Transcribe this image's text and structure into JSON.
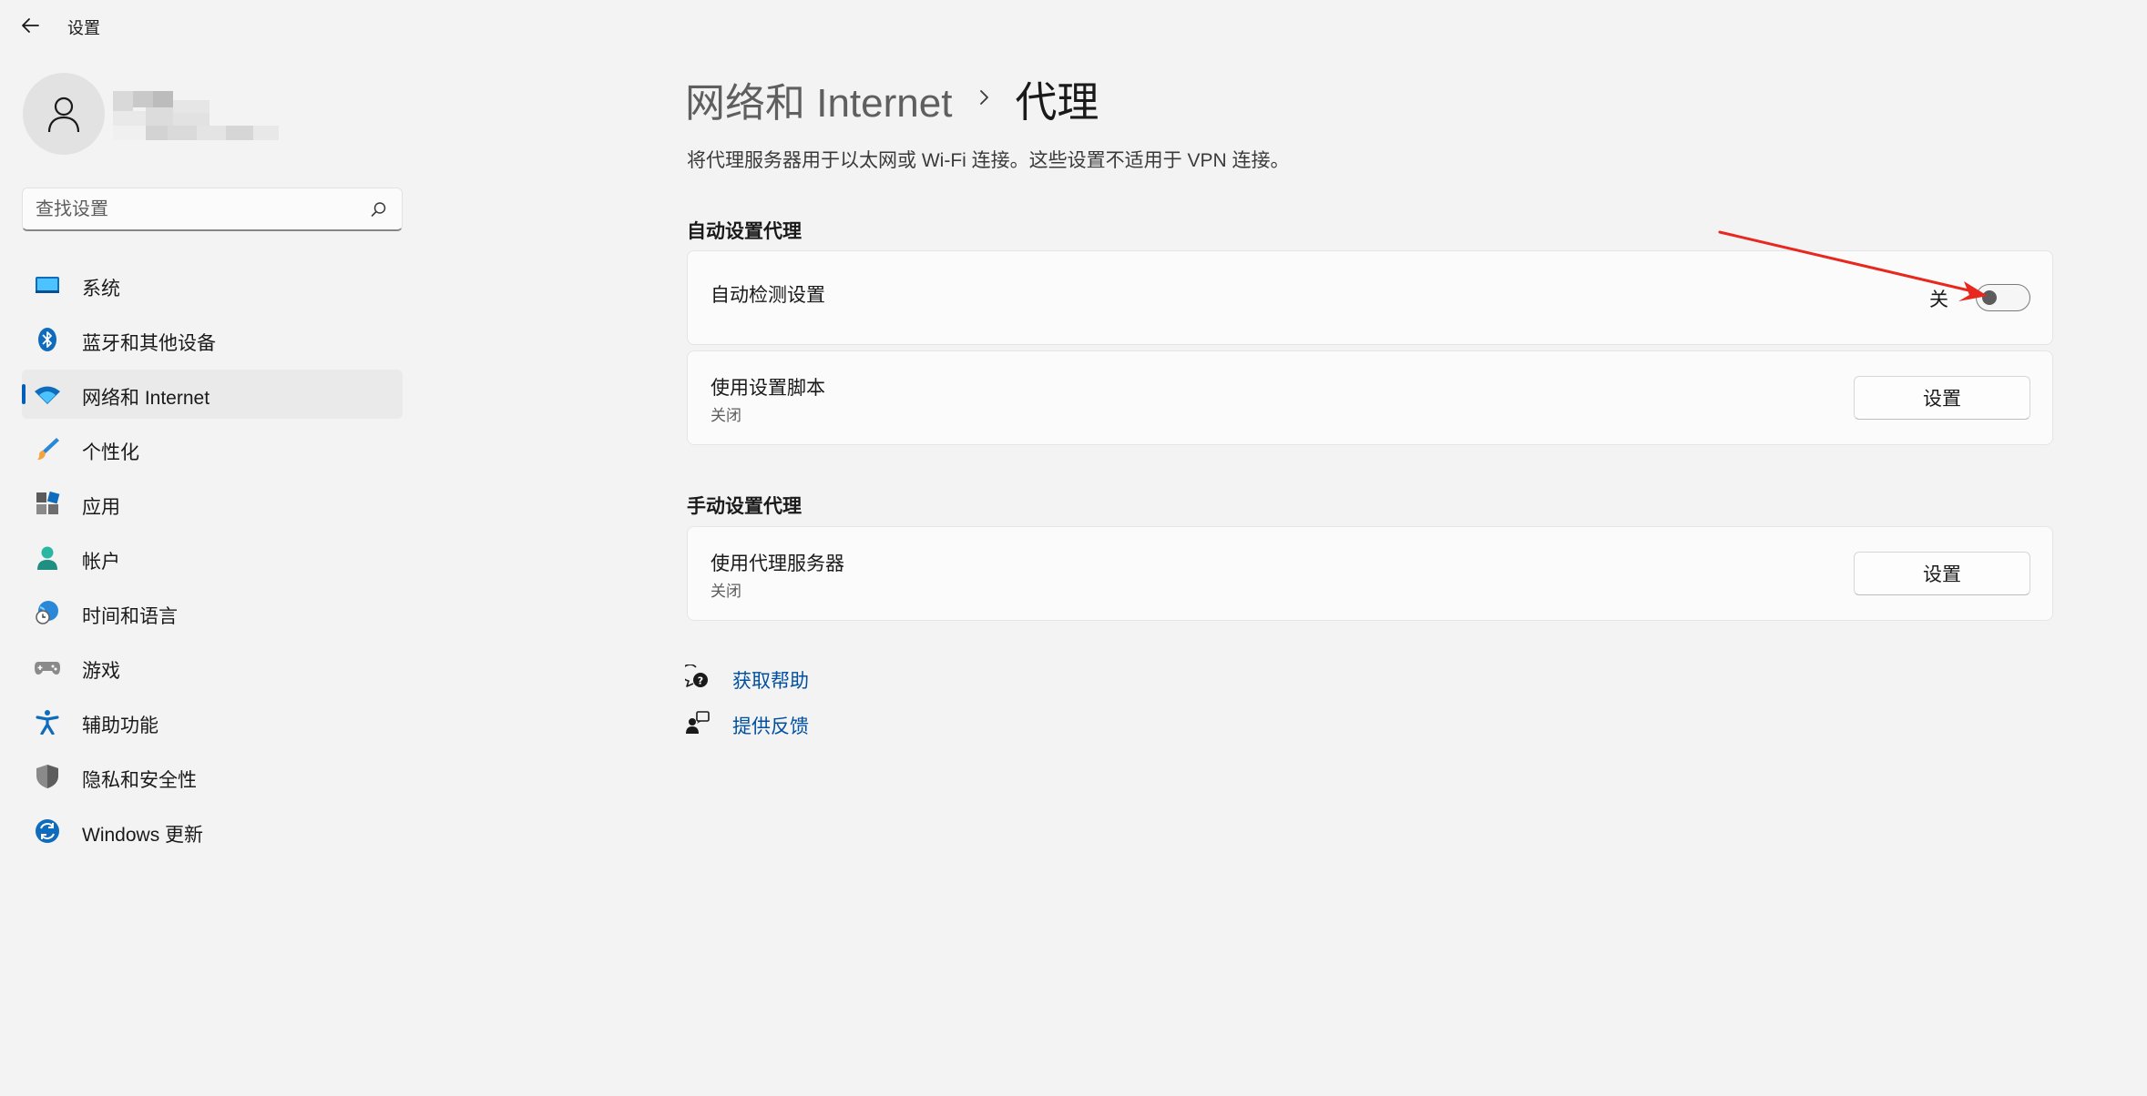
{
  "window": {
    "title": "设置"
  },
  "sidebar": {
    "search_placeholder": "查找设置",
    "items": [
      {
        "label": "系统",
        "icon": "system-display-icon",
        "active": false
      },
      {
        "label": "蓝牙和其他设备",
        "icon": "bluetooth-icon",
        "active": false
      },
      {
        "label": "网络和 Internet",
        "icon": "wifi-icon",
        "active": true
      },
      {
        "label": "个性化",
        "icon": "paintbrush-icon",
        "active": false
      },
      {
        "label": "应用",
        "icon": "apps-icon",
        "active": false
      },
      {
        "label": "帐户",
        "icon": "account-icon",
        "active": false
      },
      {
        "label": "时间和语言",
        "icon": "globe-clock-icon",
        "active": false
      },
      {
        "label": "游戏",
        "icon": "gamepad-icon",
        "active": false
      },
      {
        "label": "辅助功能",
        "icon": "accessibility-icon",
        "active": false
      },
      {
        "label": "隐私和安全性",
        "icon": "shield-icon",
        "active": false
      },
      {
        "label": "Windows 更新",
        "icon": "windows-update-icon",
        "active": false
      }
    ]
  },
  "main": {
    "breadcrumb": {
      "parent": "网络和 Internet",
      "current": "代理"
    },
    "description": "将代理服务器用于以太网或 Wi-Fi 连接。这些设置不适用于 VPN 连接。",
    "auto_section": {
      "title": "自动设置代理",
      "auto_detect": {
        "label": "自动检测设置",
        "state_text": "关",
        "enabled": false
      },
      "setup_script": {
        "label": "使用设置脚本",
        "sub": "关闭",
        "button": "设置"
      }
    },
    "manual_section": {
      "title": "手动设置代理",
      "proxy_server": {
        "label": "使用代理服务器",
        "sub": "关闭",
        "button": "设置"
      }
    },
    "links": {
      "help": "获取帮助",
      "feedback": "提供反馈"
    }
  },
  "colors": {
    "accent": "#005fb8",
    "link": "#0050a0",
    "annotation_arrow": "#e8271e"
  }
}
